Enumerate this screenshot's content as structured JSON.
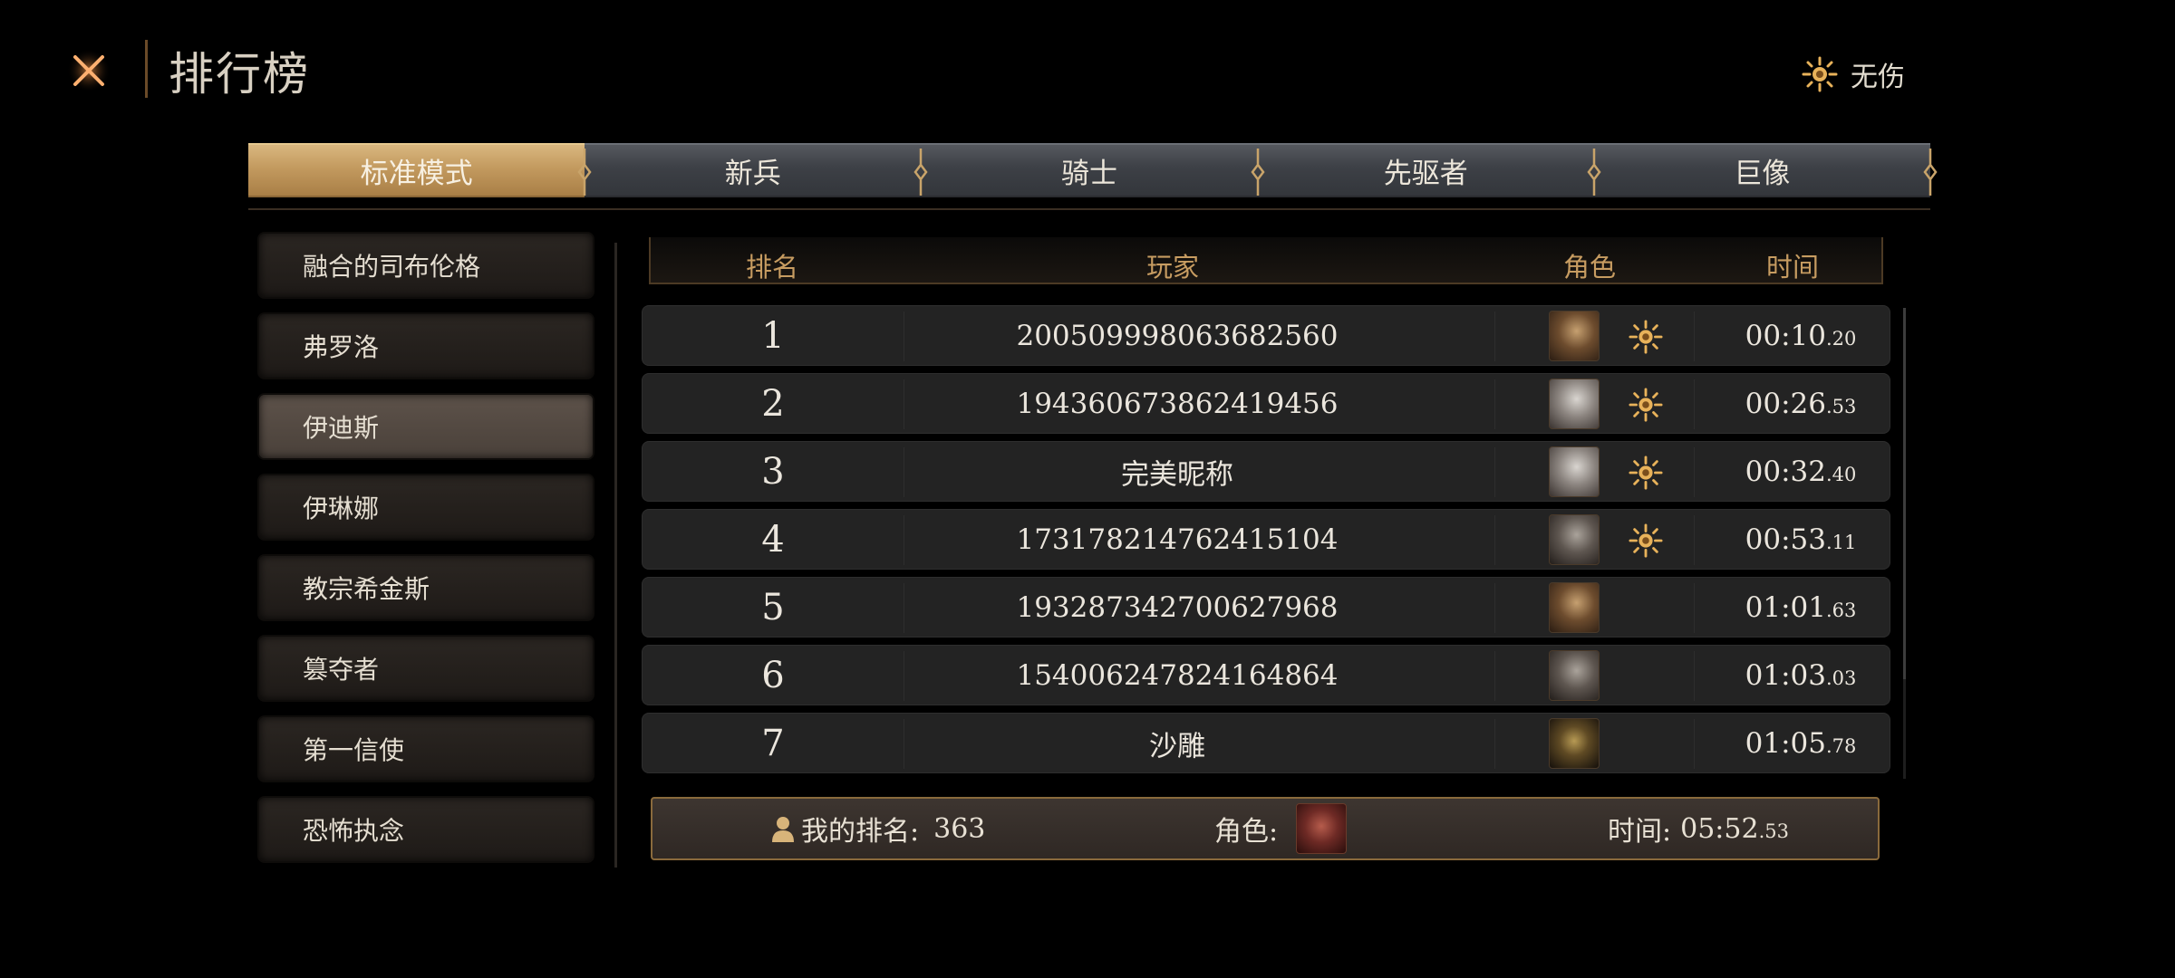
{
  "header": {
    "title": "排行榜",
    "mode_label": "无伤"
  },
  "tabs": [
    {
      "label": "标准模式",
      "active": true
    },
    {
      "label": "新兵",
      "active": false
    },
    {
      "label": "骑士",
      "active": false
    },
    {
      "label": "先驱者",
      "active": false
    },
    {
      "label": "巨像",
      "active": false
    }
  ],
  "sidebar": {
    "items": [
      {
        "label": "融合的司布伦格",
        "active": false
      },
      {
        "label": "弗罗洛",
        "active": false
      },
      {
        "label": "伊迪斯",
        "active": true
      },
      {
        "label": "伊琳娜",
        "active": false
      },
      {
        "label": "教宗希金斯",
        "active": false
      },
      {
        "label": "篡夺者",
        "active": false
      },
      {
        "label": "第一信使",
        "active": false
      },
      {
        "label": "恐怖执念",
        "active": false
      }
    ]
  },
  "table": {
    "headers": {
      "rank": "排名",
      "player": "玩家",
      "role": "角色",
      "time": "时间"
    },
    "rows": [
      {
        "rank": "1",
        "player": "200509998063682560",
        "avatar": "gold-haired-hero",
        "badge": true,
        "time_main": "00:10",
        "time_frac": ".20"
      },
      {
        "rank": "2",
        "player": "194360673862419456",
        "avatar": "silver-haired-heroine",
        "badge": true,
        "time_main": "00:26",
        "time_frac": ".53"
      },
      {
        "rank": "3",
        "player": "完美昵称",
        "avatar": "silver-haired-heroine",
        "badge": true,
        "time_main": "00:32",
        "time_frac": ".40"
      },
      {
        "rank": "4",
        "player": "173178214762415104",
        "avatar": "grey-haired-elder",
        "badge": true,
        "time_main": "00:53",
        "time_frac": ".11"
      },
      {
        "rank": "5",
        "player": "193287342700627968",
        "avatar": "gold-haired-hero",
        "badge": false,
        "time_main": "01:01",
        "time_frac": ".63"
      },
      {
        "rank": "6",
        "player": "154006247824164864",
        "avatar": "grey-haired-elder",
        "badge": false,
        "time_main": "01:03",
        "time_frac": ".03"
      },
      {
        "rank": "7",
        "player": "沙雕",
        "avatar": "golden-mask",
        "badge": false,
        "time_main": "01:05",
        "time_frac": ".78"
      }
    ]
  },
  "my_rank": {
    "rank_label": "我的排名:",
    "rank_value": "363",
    "role_label": "角色:",
    "avatar": "red-hooded-figure",
    "time_label": "时间:",
    "time_main": "05:52",
    "time_frac": ".53"
  },
  "colors": {
    "accent_gold": "#c79c61",
    "tab_active": "#c39a5f",
    "badge_gold": "#e8b25a",
    "close_orange": "#e0743a"
  }
}
